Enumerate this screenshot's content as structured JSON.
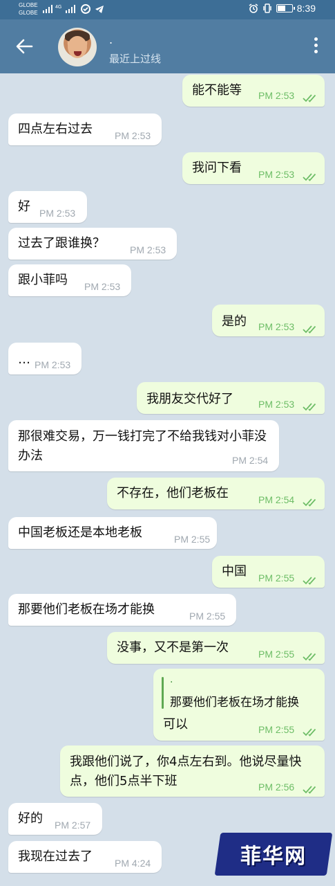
{
  "status_bar": {
    "carrier_1": "GLOBE",
    "carrier_2": "GLOBE",
    "network_badge": "4G",
    "time": "8:39",
    "battery_percent": 60
  },
  "header": {
    "contact_name": ".",
    "contact_status": "最近上过线"
  },
  "messages": [
    {
      "dir": "out",
      "text": "能不能等",
      "time": "PM 2:53"
    },
    {
      "dir": "in",
      "text": "四点左右过去",
      "time": "PM 2:53"
    },
    {
      "dir": "out",
      "text": "我问下看",
      "time": "PM 2:53"
    },
    {
      "dir": "in",
      "text": "好",
      "time": "PM 2:53"
    },
    {
      "dir": "in",
      "text": "过去了跟谁换？",
      "time": "PM 2:53"
    },
    {
      "dir": "in",
      "text": "跟小菲吗",
      "time": "PM 2:53"
    },
    {
      "dir": "out",
      "text": "是的",
      "time": "PM 2:53"
    },
    {
      "dir": "in",
      "text": "…",
      "time": "PM 2:53"
    },
    {
      "dir": "out",
      "text": "我朋友交代好了",
      "time": "PM 2:53"
    },
    {
      "dir": "in",
      "text": "那很难交易，万一钱打完了不给我钱对小菲没办法",
      "time": "PM 2:54"
    },
    {
      "dir": "out",
      "text": "不存在，他们老板在",
      "time": "PM 2:54"
    },
    {
      "dir": "in",
      "text": "中国老板还是本地老板",
      "time": "PM 2:55"
    },
    {
      "dir": "out",
      "text": "中国",
      "time": "PM 2:55"
    },
    {
      "dir": "in",
      "text": "那要他们老板在场才能换",
      "time": "PM 2:55"
    },
    {
      "dir": "out",
      "text": "没事，又不是第一次",
      "time": "PM 2:55"
    },
    {
      "dir": "out",
      "quote_name": ".",
      "quote_text": "那要他们老板在场才能换",
      "text": "可以",
      "time": "PM 2:55"
    },
    {
      "dir": "out",
      "text": "我跟他们说了，你4点左右到。他说尽量快点，他们5点半下班",
      "time": "PM 2:56"
    },
    {
      "dir": "in",
      "text": "好的",
      "time": "PM 2:57"
    },
    {
      "dir": "in",
      "text": "我现在过去了",
      "time": "PM 4:24"
    }
  ],
  "watermark": "菲华网",
  "colors": {
    "header": "#517da2",
    "status_bar": "#3d6e96",
    "chat_bg": "#d4dfe9",
    "outgoing_bubble": "#effdde",
    "incoming_bubble": "#ffffff",
    "read_ticks": "#6dbd66"
  },
  "icons": {
    "back": "arrow-left-icon",
    "menu": "more-vertical-icon",
    "read_status": "double-check-icon"
  }
}
